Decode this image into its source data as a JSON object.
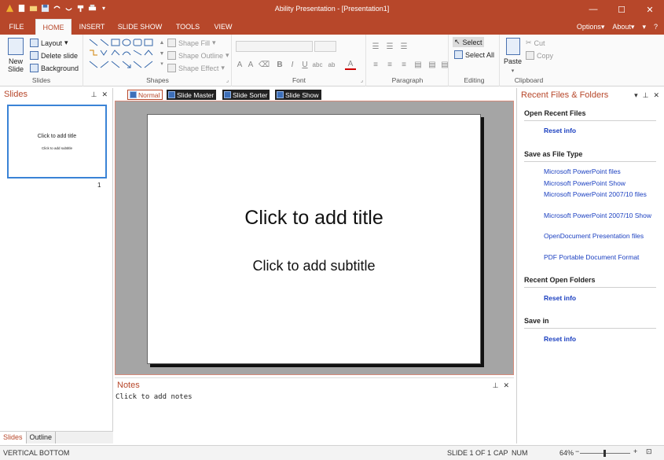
{
  "window": {
    "title": "Ability Presentation - [Presentation1]"
  },
  "tabs": [
    "FILE",
    "HOME",
    "INSERT",
    "SLIDE SHOW",
    "TOOLS",
    "VIEW"
  ],
  "tab_right": {
    "options": "Options",
    "about": "About",
    "arrows": "▾",
    "help": "?"
  },
  "ribbon": {
    "slides": {
      "new_slide": "New Slide",
      "layout": "Layout",
      "delete_slide": "Delete slide",
      "background": "Background",
      "label": "Slides"
    },
    "shapes": {
      "shape_fill": "Shape Fill",
      "shape_outline": "Shape Outline",
      "shape_effect": "Shape Effect",
      "label": "Shapes"
    },
    "font": {
      "label": "Font"
    },
    "paragraph": {
      "label": "Paragraph"
    },
    "editing": {
      "select": "Select",
      "select_all": "Select All",
      "label": "Editing"
    },
    "clipboard": {
      "paste": "Paste",
      "cut": "Cut",
      "copy": "Copy",
      "label": "Clipboard"
    }
  },
  "slides_pane": {
    "title": "Slides",
    "thumb_title": "Click to add title",
    "thumb_subtitle": "Click to add subtitle",
    "slide_number": "1",
    "tab_slides": "Slides",
    "tab_outline": "Outline"
  },
  "view_tabs": [
    "Normal",
    "Slide Master",
    "Slide Sorter",
    "Slide Show"
  ],
  "slide": {
    "title": "Click to add title",
    "subtitle": "Click to add subtitle"
  },
  "notes": {
    "title": "Notes",
    "placeholder": "Click to add notes"
  },
  "right_pane": {
    "title": "Recent Files & Folders",
    "open_recent_files": "Open Recent Files",
    "reset_info_1": "Reset info",
    "save_as_type": "Save as File Type",
    "file_types": [
      "Microsoft PowerPoint files",
      "Microsoft PowerPoint Show",
      "Microsoft PowerPoint 2007/10 files",
      "Microsoft PowerPoint 2007/10 Show",
      "OpenDocument Presentation files",
      "PDF Portable Document Format"
    ],
    "recent_open_folders": "Recent Open Folders",
    "reset_info_2": "Reset info",
    "save_in": "Save in",
    "reset_info_3": "Reset info"
  },
  "status": {
    "mode": "VERTICAL BOTTOM",
    "slide": "SLIDE 1 OF 1",
    "cap": "CAP",
    "num": "NUM",
    "zoom": "64%"
  },
  "colors": {
    "accent": "#b7472a",
    "link": "#1a3fc0",
    "selection": "#3a83d6"
  }
}
